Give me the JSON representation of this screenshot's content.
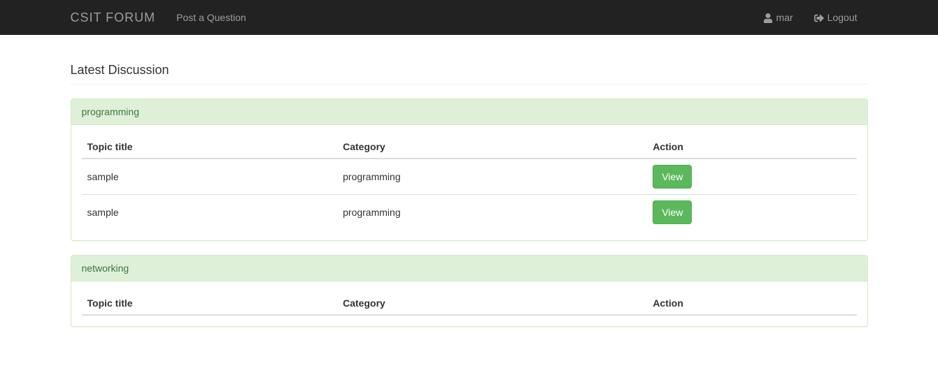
{
  "navbar": {
    "brand": "CSIT FORUM",
    "post_question": "Post a Question",
    "username": "mar",
    "logout": "Logout"
  },
  "page": {
    "heading": "Latest Discussion"
  },
  "table_headers": {
    "topic": "Topic title",
    "category": "Category",
    "action": "Action"
  },
  "buttons": {
    "view": "View"
  },
  "panels": [
    {
      "title": "programming",
      "rows": [
        {
          "topic": "sample",
          "category": "programming"
        },
        {
          "topic": "sample",
          "category": "programming"
        }
      ]
    },
    {
      "title": "networking",
      "rows": []
    }
  ]
}
